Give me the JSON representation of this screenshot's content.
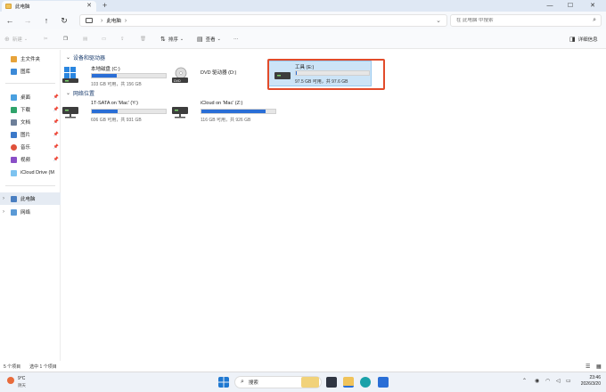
{
  "window": {
    "tab_title": "此电脑",
    "tab_close": "✕",
    "new_tab": "+",
    "minimize": "—",
    "maximize": "☐",
    "close": "✕"
  },
  "address": {
    "crumb_separator": "›",
    "crumb": "此电脑",
    "expand": "⌄",
    "search_placeholder": "在 此电脑 中搜索"
  },
  "commands": {
    "new": "新建",
    "sort": "排序",
    "view": "查看",
    "more": "···",
    "details": "详细信息"
  },
  "sidebar": {
    "items": [
      {
        "label": "主文件夹"
      },
      {
        "label": "图库"
      },
      {
        "label": "桌面"
      },
      {
        "label": "下载"
      },
      {
        "label": "文档"
      },
      {
        "label": "图片"
      },
      {
        "label": "音乐"
      },
      {
        "label": "视频"
      },
      {
        "label": "iCloud Drive (M"
      },
      {
        "label": "此电脑"
      },
      {
        "label": "网络"
      }
    ]
  },
  "main": {
    "group_devices": "设备和驱动器",
    "group_network": "网络位置",
    "drives": [
      {
        "name": "本地磁盘 (C:)",
        "sub": "103 GB 可用，共 156 GB",
        "used_fraction": 0.34
      },
      {
        "name": "DVD 驱动器 (D:)",
        "sub": ""
      },
      {
        "name": "工具 (E:)",
        "sub": "97.5 GB 可用，共 97.6 GB",
        "used_fraction": 0.01
      },
      {
        "name": "1T-SATA on 'Mac' (Y:)",
        "sub": "606 GB 可用，共 931 GB",
        "used_fraction": 0.35
      },
      {
        "name": "iCloud on 'Mac' (Z:)",
        "sub": "116 GB 可用，共 926 GB",
        "used_fraction": 0.87
      }
    ]
  },
  "status": {
    "count": "5 个项目",
    "selection": "选中 1 个项目"
  },
  "taskbar": {
    "temperature": "9°C",
    "condition": "阴天",
    "search_label": "搜索",
    "time": "23:46",
    "date": "2026/3/20"
  },
  "colors": {
    "accent": "#2a6ed6",
    "highlight_box": "#e24b2a",
    "selection": "#cce4f7"
  }
}
